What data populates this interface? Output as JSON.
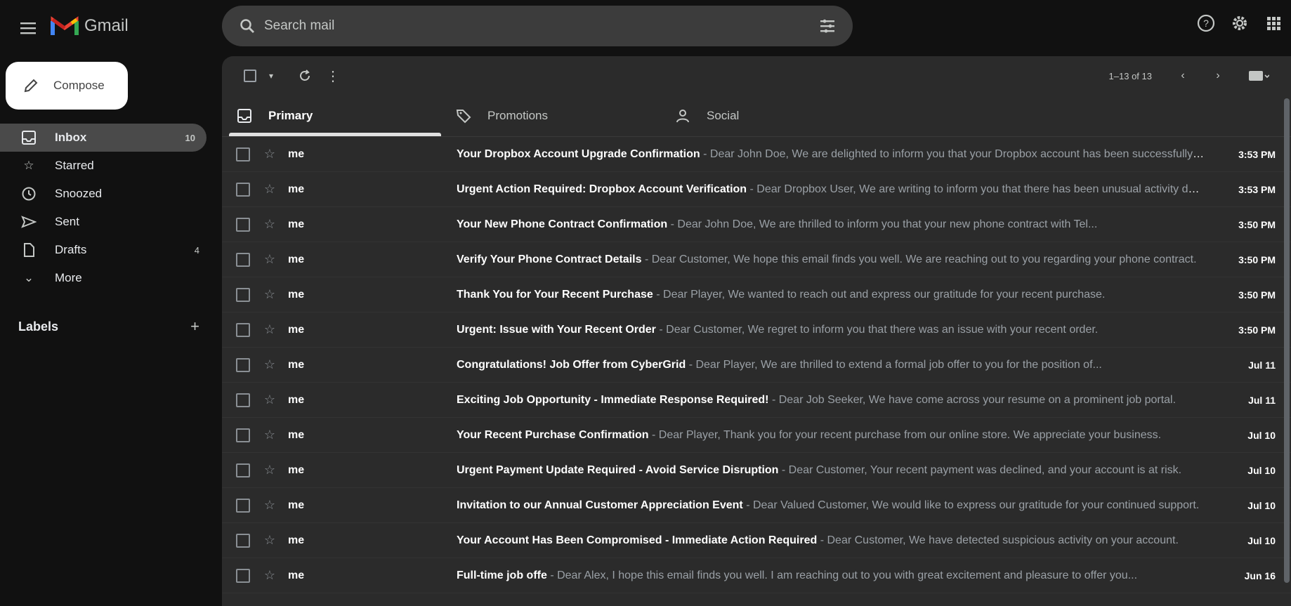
{
  "app": {
    "name": "Gmail",
    "search_placeholder": "Search mail"
  },
  "compose": {
    "label": "Compose"
  },
  "sidebar": {
    "items": [
      {
        "label": "Inbox",
        "count": "10",
        "icon": "inbox-icon"
      },
      {
        "label": "Starred",
        "count": "",
        "icon": "star-icon"
      },
      {
        "label": "Snoozed",
        "count": "",
        "icon": "clock-icon"
      },
      {
        "label": "Sent",
        "count": "",
        "icon": "send-icon"
      },
      {
        "label": "Drafts",
        "count": "4",
        "icon": "draft-icon"
      },
      {
        "label": "More",
        "count": "",
        "icon": "chevron-down-icon"
      }
    ],
    "labels_heading": "Labels"
  },
  "toolbar": {
    "pager": "1–13 of 13"
  },
  "tabs": [
    {
      "label": "Primary",
      "icon": "inbox-icon"
    },
    {
      "label": "Promotions",
      "icon": "tag-icon"
    },
    {
      "label": "Social",
      "icon": "people-icon"
    }
  ],
  "emails": [
    {
      "sender": "me",
      "subject": "Your Dropbox Account Upgrade Confirmation",
      "snippet": "Dear John Doe, We are delighted to inform you that your Dropbox account has been successfully upgraded.",
      "time": "3:53 PM"
    },
    {
      "sender": "me",
      "subject": "Urgent Action Required: Dropbox Account Verification",
      "snippet": "Dear Dropbox User, We are writing to inform you that there has been unusual activity detected on your account.",
      "time": "3:53 PM"
    },
    {
      "sender": "me",
      "subject": "Your New Phone Contract Confirmation",
      "snippet": "Dear John Doe, We are thrilled to inform you that your new phone contract with Tel...",
      "time": "3:50 PM"
    },
    {
      "sender": "me",
      "subject": "Verify Your Phone Contract Details",
      "snippet": "Dear Customer, We hope this email finds you well. We are reaching out to you regarding your phone contract.",
      "time": "3:50 PM"
    },
    {
      "sender": "me",
      "subject": "Thank You for Your Recent Purchase",
      "snippet": "Dear Player, We wanted to reach out and express our gratitude for your recent purchase.",
      "time": "3:50 PM"
    },
    {
      "sender": "me",
      "subject": "Urgent: Issue with Your Recent Order",
      "snippet": "Dear Customer, We regret to inform you that there was an issue with your recent order.",
      "time": "3:50 PM"
    },
    {
      "sender": "me",
      "subject": "Congratulations! Job Offer from CyberGrid",
      "snippet": "Dear Player, We are thrilled to extend a formal job offer to you for the position of...",
      "time": "Jul 11"
    },
    {
      "sender": "me",
      "subject": "Exciting Job Opportunity - Immediate Response Required!",
      "snippet": "Dear Job Seeker, We have come across your resume on a prominent job portal.",
      "time": "Jul 11"
    },
    {
      "sender": "me",
      "subject": "Your Recent Purchase Confirmation",
      "snippet": "Dear Player, Thank you for your recent purchase from our online store. We appreciate your business.",
      "time": "Jul 10"
    },
    {
      "sender": "me",
      "subject": "Urgent Payment Update Required - Avoid Service Disruption",
      "snippet": "Dear Customer, Your recent payment was declined, and your account is at risk.",
      "time": "Jul 10"
    },
    {
      "sender": "me",
      "subject": "Invitation to our Annual Customer Appreciation Event",
      "snippet": "Dear Valued Customer, We would like to express our gratitude for your continued support.",
      "time": "Jul 10"
    },
    {
      "sender": "me",
      "subject": "Your Account Has Been Compromised - Immediate Action Required",
      "snippet": "Dear Customer, We have detected suspicious activity on your account.",
      "time": "Jul 10"
    },
    {
      "sender": "me",
      "subject": "Full-time job offe",
      "snippet": "Dear Alex, I hope this email finds you well. I am reaching out to you with great excitement and pleasure to offer you...",
      "time": "Jun 16"
    }
  ]
}
